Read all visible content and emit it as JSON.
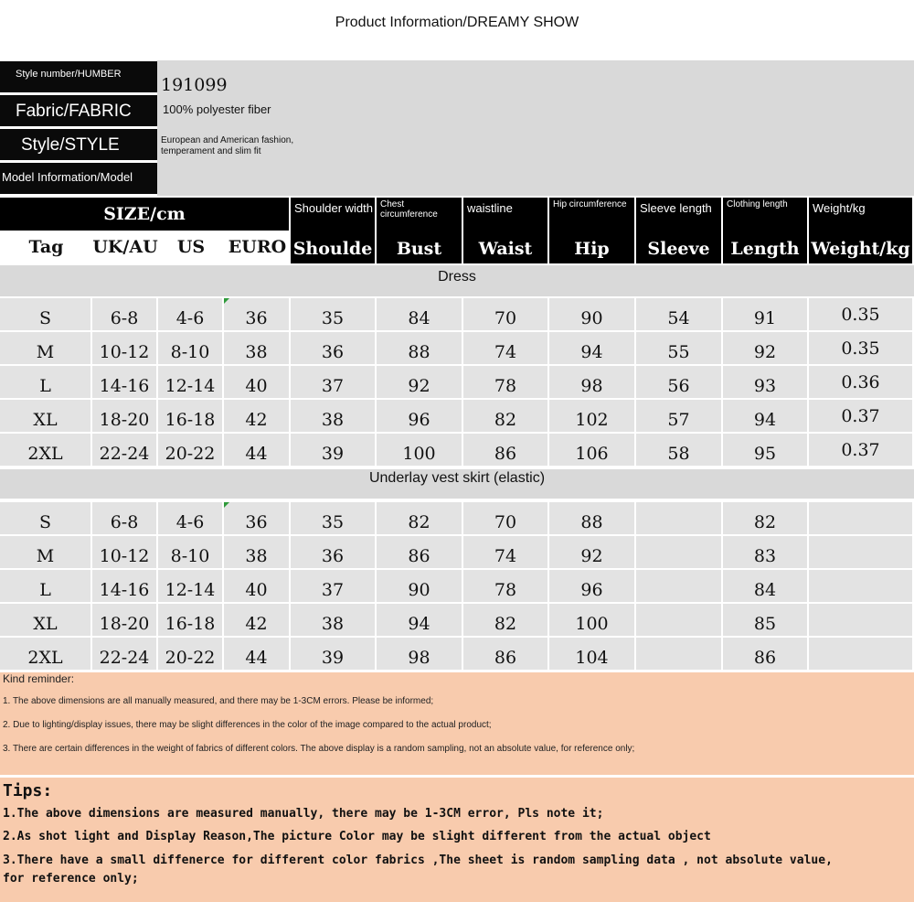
{
  "title": "Product Information/DREAMY SHOW",
  "info": [
    {
      "label": "Style number/HUMBER",
      "value": "191099"
    },
    {
      "label": "Fabric/FABRIC",
      "value": "100% polyester fiber"
    },
    {
      "label": "Style/STYLE",
      "value": "European and American fashion,",
      "value2": "temperament and slim fit"
    },
    {
      "label": "Model Information/Model",
      "value": ""
    }
  ],
  "table": {
    "size_header": "SIZE/cm",
    "size_cols": [
      "Tag",
      "UK/AU",
      "US",
      "EURO"
    ],
    "measure_cols": [
      {
        "sub": "Shoulder width",
        "main": "Shoulde"
      },
      {
        "sub": "Chest circumference",
        "main": "Bust"
      },
      {
        "sub": "waistline",
        "main": "Waist"
      },
      {
        "sub": "Hip circumference",
        "main": "Hip"
      },
      {
        "sub": "Sleeve length",
        "main": "Sleeve"
      },
      {
        "sub": "Clothing length",
        "main": "Length"
      },
      {
        "sub": "Weight/kg",
        "main": "Weight/kg"
      }
    ],
    "sections": [
      {
        "title": "Dress",
        "rows": [
          [
            "S",
            "6-8",
            "4-6",
            "36",
            "35",
            "84",
            "70",
            "90",
            "54",
            "91",
            "0.35"
          ],
          [
            "M",
            "10-12",
            "8-10",
            "38",
            "36",
            "88",
            "74",
            "94",
            "55",
            "92",
            "0.35"
          ],
          [
            "L",
            "14-16",
            "12-14",
            "40",
            "37",
            "92",
            "78",
            "98",
            "56",
            "93",
            "0.36"
          ],
          [
            "XL",
            "18-20",
            "16-18",
            "42",
            "38",
            "96",
            "82",
            "102",
            "57",
            "94",
            "0.37"
          ],
          [
            "2XL",
            "22-24",
            "20-22",
            "44",
            "39",
            "100",
            "86",
            "106",
            "58",
            "95",
            "0.37"
          ]
        ]
      },
      {
        "title": "Underlay vest skirt (elastic)",
        "rows": [
          [
            "S",
            "6-8",
            "4-6",
            "36",
            "35",
            "82",
            "70",
            "88",
            "",
            "82",
            ""
          ],
          [
            "M",
            "10-12",
            "8-10",
            "38",
            "36",
            "86",
            "74",
            "92",
            "",
            "83",
            ""
          ],
          [
            "L",
            "14-16",
            "12-14",
            "40",
            "37",
            "90",
            "78",
            "96",
            "",
            "84",
            ""
          ],
          [
            "XL",
            "18-20",
            "16-18",
            "42",
            "38",
            "94",
            "82",
            "100",
            "",
            "85",
            ""
          ],
          [
            "2XL",
            "22-24",
            "20-22",
            "44",
            "39",
            "98",
            "86",
            "104",
            "",
            "86",
            ""
          ]
        ]
      }
    ]
  },
  "reminder": {
    "heading": "Kind reminder:",
    "items": [
      "1. The above dimensions are all manually measured, and there may be 1-3CM errors. Please be informed;",
      "2. Due to lighting/display issues, there may be slight differences in the color of the image compared to the actual product;",
      "3. There are certain differences in the weight of fabrics of different colors. The above display is a random sampling, not an absolute value, for reference only;"
    ]
  },
  "tips": {
    "heading": "Tips:",
    "items": [
      "1.The above dimensions are measured manually, there may be 1-3CM error, Pls note it;",
      "2.As shot light and Display Reason,The picture Color may be slight  different from the actual object",
      "3.There have a small diffenerce for different color fabrics ,The sheet is random sampling data , not absolute value,",
      "  for reference only;"
    ]
  },
  "colors": {
    "header_bg": "#000000",
    "cell_bg": "#e3e3e3",
    "section_bg": "#d9d9d9",
    "note_bg": "#f8cbad"
  }
}
